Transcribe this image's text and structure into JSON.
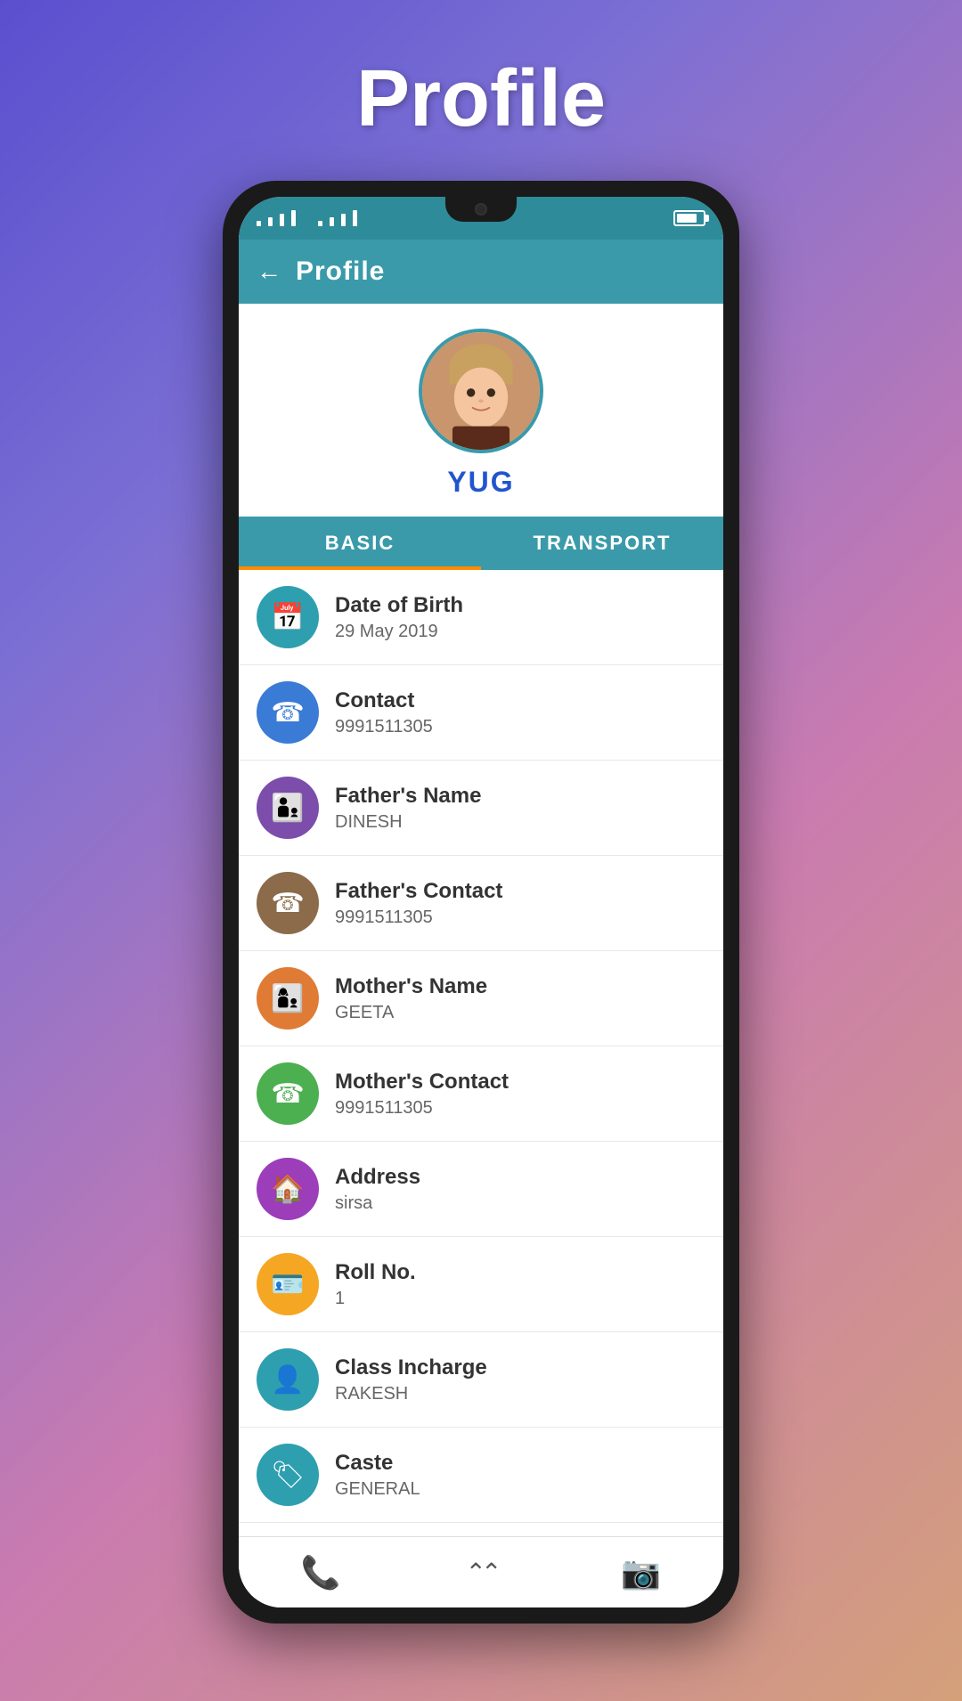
{
  "page": {
    "title": "Profile"
  },
  "header": {
    "back_label": "←",
    "title": "Profile"
  },
  "student": {
    "name": "YUG"
  },
  "tabs": [
    {
      "id": "basic",
      "label": "BASIC",
      "active": true
    },
    {
      "id": "transport",
      "label": "TRANSPORT",
      "active": false
    }
  ],
  "info_items": [
    {
      "id": "dob",
      "label": "Date of Birth",
      "value": "29 May 2019",
      "icon": "📅",
      "icon_color": "ic-teal"
    },
    {
      "id": "contact",
      "label": "Contact",
      "value": "9991511305",
      "icon": "☎",
      "icon_color": "ic-blue"
    },
    {
      "id": "fathers_name",
      "label": "Father's Name",
      "value": "DINESH",
      "icon": "👨‍👦",
      "icon_color": "ic-purple"
    },
    {
      "id": "fathers_contact",
      "label": "Father's Contact",
      "value": "9991511305",
      "icon": "☎",
      "icon_color": "ic-brown"
    },
    {
      "id": "mothers_name",
      "label": "Mother's Name",
      "value": "GEETA",
      "icon": "👩‍👦",
      "icon_color": "ic-orange"
    },
    {
      "id": "mothers_contact",
      "label": "Mother's Contact",
      "value": "9991511305",
      "icon": "☎",
      "icon_color": "ic-green"
    },
    {
      "id": "address",
      "label": "Address",
      "value": "sirsa",
      "icon": "🏠",
      "icon_color": "ic-violet"
    },
    {
      "id": "roll_no",
      "label": "Roll No.",
      "value": "1",
      "icon": "🪪",
      "icon_color": "ic-amber"
    },
    {
      "id": "class_incharge",
      "label": "Class Incharge",
      "value": "RAKESH",
      "icon": "👤",
      "icon_color": "ic-sky"
    },
    {
      "id": "caste",
      "label": "Caste",
      "value": "GENERAL",
      "icon": "🏷",
      "icon_color": "ic-teal2"
    }
  ],
  "bottom_nav": {
    "phone_icon": "📞",
    "chevron_icon": "⌃⌃",
    "camera_icon": "📷"
  }
}
